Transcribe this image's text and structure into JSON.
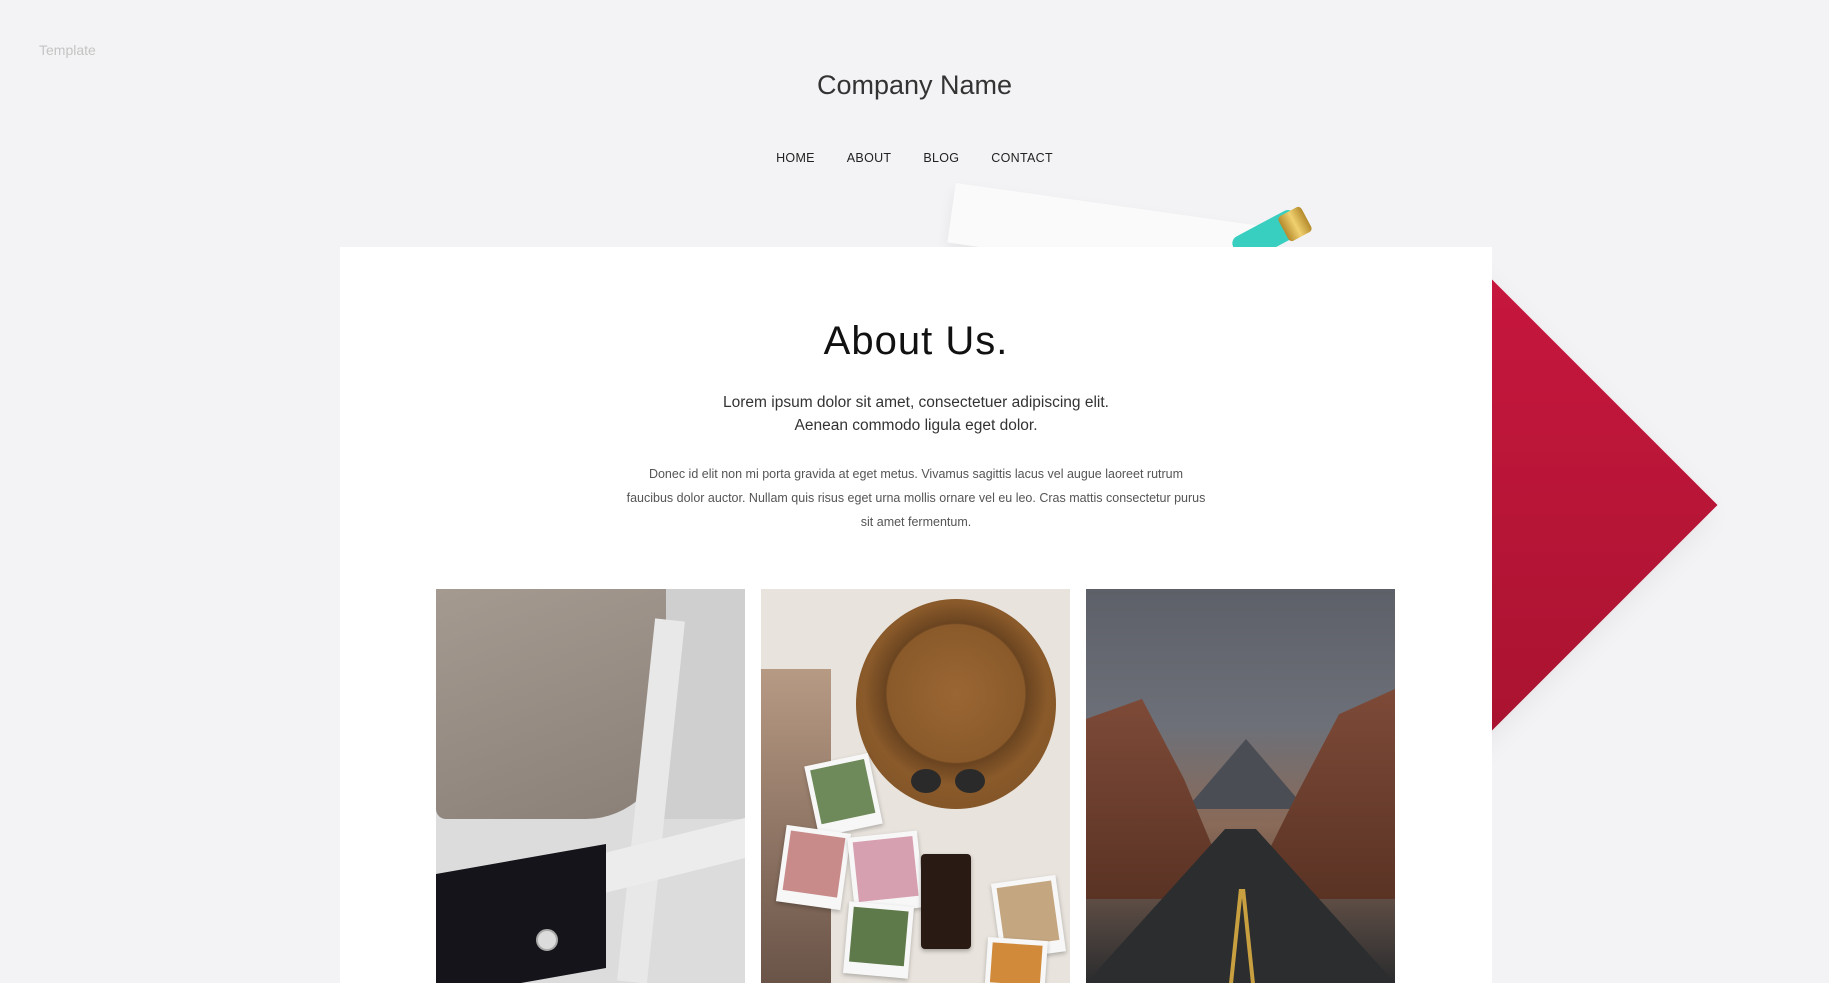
{
  "template_label": "Template",
  "header": {
    "company_name": "Company Name",
    "nav": [
      "HOME",
      "ABOUT",
      "BLOG",
      "CONTACT"
    ]
  },
  "about": {
    "title": "About Us.",
    "lead_line1": "Lorem ipsum dolor sit amet, consectetuer adipiscing elit.",
    "lead_line2": "Aenean commodo ligula eget dolor.",
    "body": "Donec id elit non mi porta gravida at eget metus. Vivamus sagittis lacus vel augue laoreet rutrum faucibus dolor auctor. Nullam quis risus eget urna mollis ornare vel eu leo. Cras mattis consectetur purus sit amet fermentum."
  },
  "gallery": [
    {
      "subject": "clothes-on-chair"
    },
    {
      "subject": "hat-and-photos"
    },
    {
      "subject": "desert-road"
    }
  ],
  "colors": {
    "background": "#f3f3f5",
    "accent_red": "#c8173f",
    "card": "#ffffff"
  }
}
